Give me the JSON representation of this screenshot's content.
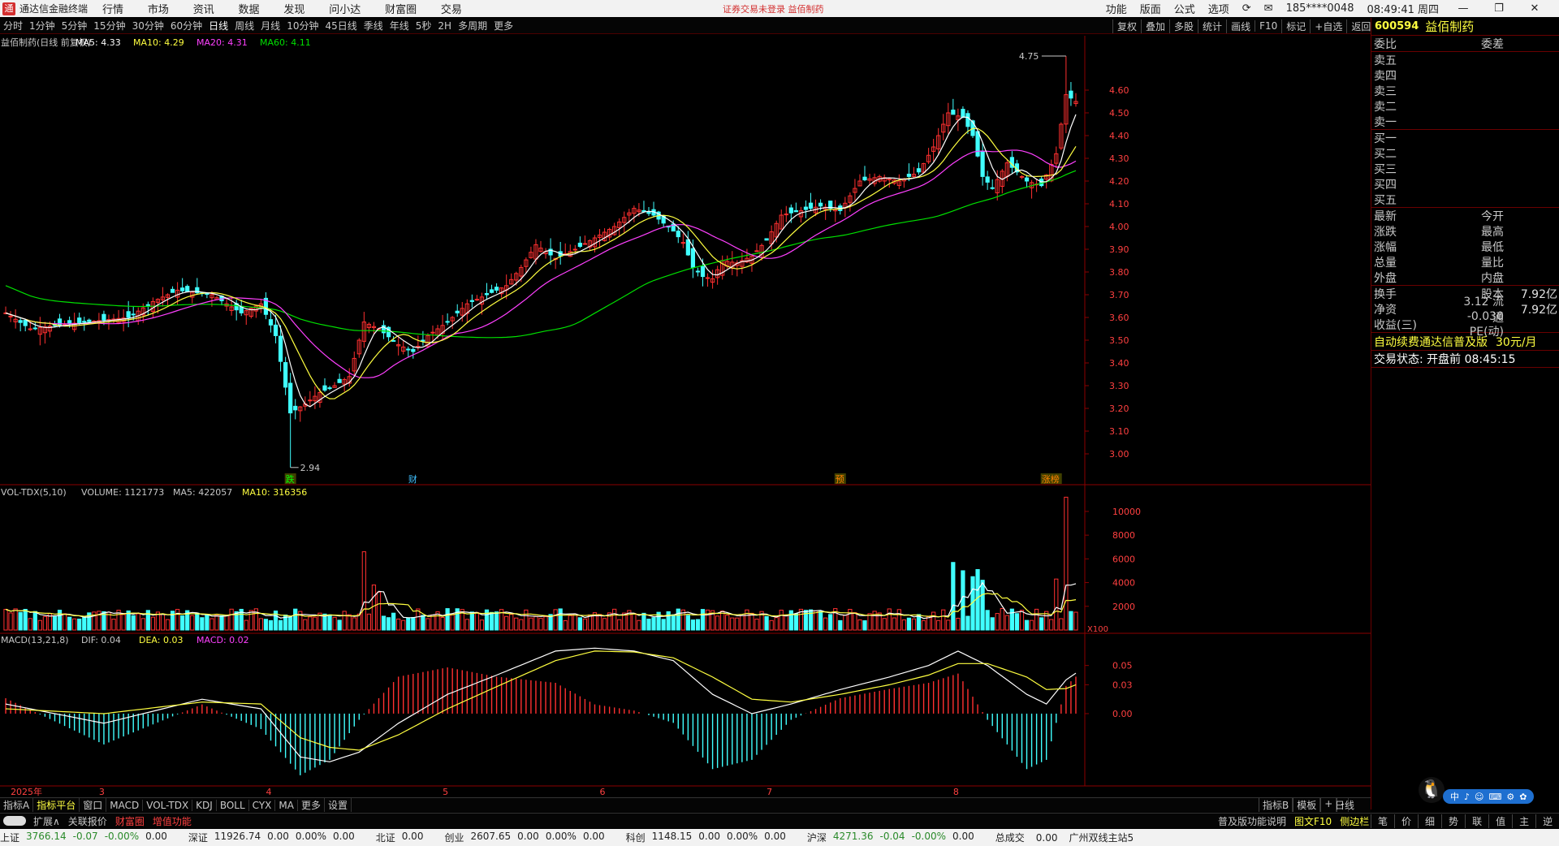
{
  "titlebar": {
    "app_name": "通达信金融终端",
    "menu": [
      "行情",
      "市场",
      "资讯",
      "数据",
      "发现",
      "问小达",
      "财富圈",
      "交易"
    ],
    "center_notice": "证券交易未登录  益佰制药",
    "right_menu": [
      "功能",
      "版面",
      "公式",
      "选项"
    ],
    "user": "185****0048",
    "time": "08:49:41 周四"
  },
  "periods": [
    "分时",
    "1分钟",
    "5分钟",
    "15分钟",
    "30分钟",
    "60分钟",
    "日线",
    "周线",
    "月线",
    "10分钟",
    "45日线",
    "季线",
    "年线",
    "5秒",
    "2H",
    "多周期",
    "更多"
  ],
  "active_period": "日线",
  "toolbar_right": [
    "复权",
    "叠加",
    "多股",
    "统计",
    "画线",
    "F10",
    "标记",
    "+自选",
    "返回"
  ],
  "chart_data": [
    {
      "type": "candlestick",
      "title": "益佰制药(日线 前复权)",
      "ma_labels": {
        "ma5": "MA5: 4.33",
        "ma10": "MA10: 4.29",
        "ma20": "MA20: 4.31",
        "ma60": "MA60: 4.11"
      },
      "colors": {
        "ma5": "#ffffff",
        "ma10": "#ffff40",
        "ma20": "#ff40ff",
        "ma60": "#00e000",
        "up": "#ff3030",
        "down": "#40ffff"
      },
      "ylim": [
        2.9,
        4.8
      ],
      "y_ticks": [
        4.6,
        4.5,
        4.4,
        4.3,
        4.2,
        4.1,
        4.0,
        3.9,
        3.8,
        3.7,
        3.6,
        3.5,
        3.4,
        3.3,
        3.2,
        3.1,
        3.0
      ],
      "annotations": [
        {
          "label": "4.75",
          "kind": "high"
        },
        {
          "label": "2.94",
          "kind": "low"
        }
      ],
      "event_markers": [
        {
          "label": "跌",
          "bar": 58
        },
        {
          "label": "财",
          "bar": 83
        },
        {
          "label": "预",
          "bar": 170
        },
        {
          "label": "涨榜",
          "bar": 212
        }
      ],
      "x_labels": [
        {
          "label": "2025年",
          "bar": 1
        },
        {
          "label": "3",
          "bar": 19
        },
        {
          "label": "4",
          "bar": 53
        },
        {
          "label": "5",
          "bar": 89
        },
        {
          "label": "6",
          "bar": 121
        },
        {
          "label": "7",
          "bar": 155
        },
        {
          "label": "8",
          "bar": 193
        }
      ],
      "keypoints_close": [
        [
          0,
          3.62
        ],
        [
          5,
          3.55
        ],
        [
          12,
          3.57
        ],
        [
          25,
          3.6
        ],
        [
          30,
          3.67
        ],
        [
          35,
          3.72
        ],
        [
          42,
          3.7
        ],
        [
          48,
          3.62
        ],
        [
          52,
          3.66
        ],
        [
          55,
          3.52
        ],
        [
          58,
          3.18
        ],
        [
          61,
          3.22
        ],
        [
          64,
          3.27
        ],
        [
          67,
          3.3
        ],
        [
          70,
          3.34
        ],
        [
          73,
          3.58
        ],
        [
          76,
          3.55
        ],
        [
          80,
          3.48
        ],
        [
          83,
          3.45
        ],
        [
          86,
          3.52
        ],
        [
          90,
          3.58
        ],
        [
          94,
          3.66
        ],
        [
          98,
          3.7
        ],
        [
          102,
          3.74
        ],
        [
          105,
          3.82
        ],
        [
          108,
          3.92
        ],
        [
          112,
          3.86
        ],
        [
          116,
          3.9
        ],
        [
          120,
          3.95
        ],
        [
          124,
          4.0
        ],
        [
          128,
          4.08
        ],
        [
          132,
          4.05
        ],
        [
          136,
          3.98
        ],
        [
          138,
          3.93
        ],
        [
          140,
          3.82
        ],
        [
          142,
          3.78
        ],
        [
          144,
          3.77
        ],
        [
          146,
          3.85
        ],
        [
          149,
          3.84
        ],
        [
          152,
          3.87
        ],
        [
          155,
          3.94
        ],
        [
          158,
          4.05
        ],
        [
          162,
          4.07
        ],
        [
          166,
          4.09
        ],
        [
          170,
          4.07
        ],
        [
          174,
          4.2
        ],
        [
          178,
          4.22
        ],
        [
          182,
          4.2
        ],
        [
          186,
          4.24
        ],
        [
          189,
          4.35
        ],
        [
          192,
          4.5
        ],
        [
          195,
          4.48
        ],
        [
          197,
          4.4
        ],
        [
          199,
          4.22
        ],
        [
          201,
          4.17
        ],
        [
          204,
          4.28
        ],
        [
          206,
          4.24
        ],
        [
          208,
          4.2
        ],
        [
          211,
          4.18
        ],
        [
          214,
          4.32
        ],
        [
          216,
          4.58
        ],
        [
          218,
          4.55
        ]
      ]
    },
    {
      "type": "bar",
      "title": "VOL-TDX(5,10)",
      "labels": {
        "volume": "VOLUME: 1121773",
        "ma5": "MA5: 422057",
        "ma10": "MA10: 316356"
      },
      "y_ticks": [
        10000,
        8000,
        6000,
        4000,
        2000
      ],
      "unit_label": "X100",
      "ylim": [
        0,
        11500
      ],
      "spikes": [
        [
          73,
          6600
        ],
        [
          75,
          3800
        ],
        [
          76,
          3200
        ],
        [
          193,
          5700
        ],
        [
          195,
          5000
        ],
        [
          197,
          4500
        ],
        [
          198,
          5100
        ],
        [
          199,
          4200
        ],
        [
          214,
          4300
        ],
        [
          216,
          11200
        ]
      ],
      "base": 1300
    },
    {
      "type": "bar",
      "title": "MACD(13,21,8)",
      "labels": {
        "dif": "DIF: 0.04",
        "dea": "DEA: 0.03",
        "macd": "MACD: 0.02"
      },
      "y_ticks": [
        0.05,
        0.03,
        0.0
      ],
      "ylim": [
        -0.07,
        0.075
      ],
      "dif_keypoints": [
        [
          0,
          0.01
        ],
        [
          20,
          -0.01
        ],
        [
          40,
          0.015
        ],
        [
          52,
          0.005
        ],
        [
          60,
          -0.045
        ],
        [
          66,
          -0.05
        ],
        [
          72,
          -0.04
        ],
        [
          80,
          -0.01
        ],
        [
          90,
          0.02
        ],
        [
          100,
          0.04
        ],
        [
          112,
          0.065
        ],
        [
          120,
          0.068
        ],
        [
          128,
          0.065
        ],
        [
          136,
          0.055
        ],
        [
          144,
          0.02
        ],
        [
          152,
          0.0
        ],
        [
          160,
          0.01
        ],
        [
          170,
          0.025
        ],
        [
          180,
          0.038
        ],
        [
          188,
          0.05
        ],
        [
          194,
          0.065
        ],
        [
          200,
          0.05
        ],
        [
          208,
          0.02
        ],
        [
          212,
          0.01
        ],
        [
          216,
          0.035
        ],
        [
          218,
          0.042
        ]
      ],
      "dea_keypoints": [
        [
          0,
          0.005
        ],
        [
          20,
          0.0
        ],
        [
          40,
          0.012
        ],
        [
          52,
          0.01
        ],
        [
          60,
          -0.025
        ],
        [
          66,
          -0.035
        ],
        [
          72,
          -0.038
        ],
        [
          80,
          -0.022
        ],
        [
          90,
          0.005
        ],
        [
          100,
          0.028
        ],
        [
          112,
          0.055
        ],
        [
          120,
          0.065
        ],
        [
          128,
          0.064
        ],
        [
          136,
          0.058
        ],
        [
          144,
          0.038
        ],
        [
          152,
          0.015
        ],
        [
          160,
          0.012
        ],
        [
          170,
          0.02
        ],
        [
          180,
          0.03
        ],
        [
          188,
          0.04
        ],
        [
          194,
          0.052
        ],
        [
          200,
          0.052
        ],
        [
          208,
          0.038
        ],
        [
          212,
          0.025
        ],
        [
          216,
          0.026
        ],
        [
          218,
          0.03
        ]
      ]
    }
  ],
  "quote_panel": {
    "code": "600594",
    "name": "益佰制药",
    "header": [
      "委比",
      "委差"
    ],
    "sells": [
      "卖五",
      "卖四",
      "卖三",
      "卖二",
      "卖一"
    ],
    "buys": [
      "买一",
      "买二",
      "买三",
      "买四",
      "买五"
    ],
    "stats": [
      {
        "a": "最新",
        "b": "今开",
        "c": ""
      },
      {
        "a": "涨跌",
        "b": "最高",
        "c": ""
      },
      {
        "a": "涨幅",
        "b": "最低",
        "c": ""
      },
      {
        "a": "总量",
        "b": "量比",
        "c": ""
      },
      {
        "a": "外盘",
        "b": "内盘",
        "c": ""
      }
    ],
    "stats2": [
      {
        "a": "换手",
        "b": "股本",
        "c": "7.92亿"
      },
      {
        "a": "净资",
        "b": "3.12 流通",
        "c": "7.92亿"
      },
      {
        "a": "收益(三)",
        "b": "-0.030 PE(动)",
        "c": ""
      }
    ],
    "ad_text": "自动续费通达信普及版",
    "ad_price": "30元/月",
    "trade_state": "交易状态: 开盘前 08:45:15",
    "qq_tools": [
      "中",
      "♪",
      "☺",
      "⌨",
      "⚙",
      "✿"
    ]
  },
  "tabs_row1": [
    "指标A",
    "指标平台",
    "窗口",
    "MACD",
    "VOL-TDX",
    "KDJ",
    "BOLL",
    "CYX",
    "MA",
    "更多",
    "设置"
  ],
  "tabs_row1_right": [
    "指标B",
    "模板",
    "+",
    "-"
  ],
  "period_right_label": "日线",
  "tabs_row2": [
    "扩展∧",
    "关联报价",
    "财富圈",
    "增值功能"
  ],
  "tabs_row2_right": [
    "普及版功能说明",
    "图文F10",
    "侧边栏"
  ],
  "tabs_row2_side": [
    "笔",
    "价",
    "细",
    "势",
    "联",
    "值",
    "主",
    "逆",
    "⋯"
  ],
  "status_bar": [
    {
      "name": "上证",
      "value": "3766.14",
      "chg": "-0.07",
      "pct": "-0.00%",
      "amt": "0.00"
    },
    {
      "name": "深证",
      "value": "11926.74",
      "chg": "0.00",
      "pct": "0.00%",
      "amt": "0.00"
    },
    {
      "name": "北证",
      "value": "",
      "chg": "",
      "pct": "",
      "amt": "0.00"
    },
    {
      "name": "创业",
      "value": "2607.65",
      "chg": "0.00",
      "pct": "0.00%",
      "amt": "0.00"
    },
    {
      "name": "科创",
      "value": "1148.15",
      "chg": "0.00",
      "pct": "0.00%",
      "amt": "0.00"
    },
    {
      "name": "沪深",
      "value": "4271.36",
      "chg": "-0.04",
      "pct": "-0.00%",
      "amt": "0.00"
    }
  ],
  "status_total": "总成交",
  "status_total_value": "0.00",
  "status_server": "广州双线主站5"
}
